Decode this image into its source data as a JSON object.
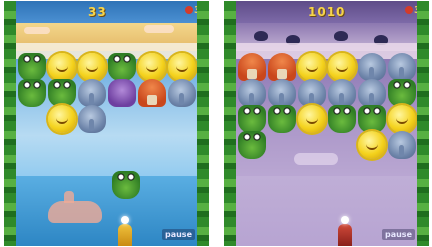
{
  "screens": [
    {
      "id": "left",
      "score": "33",
      "lives": "3",
      "button_label": "pause",
      "colors": {
        "sky": "#5ea2dc",
        "sand": "#e4b766",
        "vine": "#2f8a2a"
      },
      "board": [
        [
          "frog",
          "sun",
          "sun",
          "frog",
          "sun",
          "sun"
        ],
        [
          "frog",
          "frog",
          "ele",
          "purp",
          "mush",
          "ele"
        ],
        [
          null,
          "sun",
          "ele",
          null,
          null,
          null
        ]
      ],
      "shooter_piece": "frog"
    },
    {
      "id": "right",
      "score": "1010",
      "lives": "3",
      "button_label": "pause",
      "colors": {
        "sky": "#8d7ab5",
        "sand": "#c6b4d6",
        "vine": "#2f8a2a"
      },
      "board": [
        [
          "mush",
          "mush",
          "sun",
          "sun",
          "ele",
          "ele"
        ],
        [
          "ele",
          "ele",
          "ele",
          "ele",
          "ele",
          "frog"
        ],
        [
          "frog",
          "frog",
          "sun",
          "frog",
          "frog",
          "sun"
        ],
        [
          "frog",
          null,
          null,
          null,
          "sun",
          "ele"
        ]
      ],
      "shooter_piece": "mush"
    }
  ]
}
